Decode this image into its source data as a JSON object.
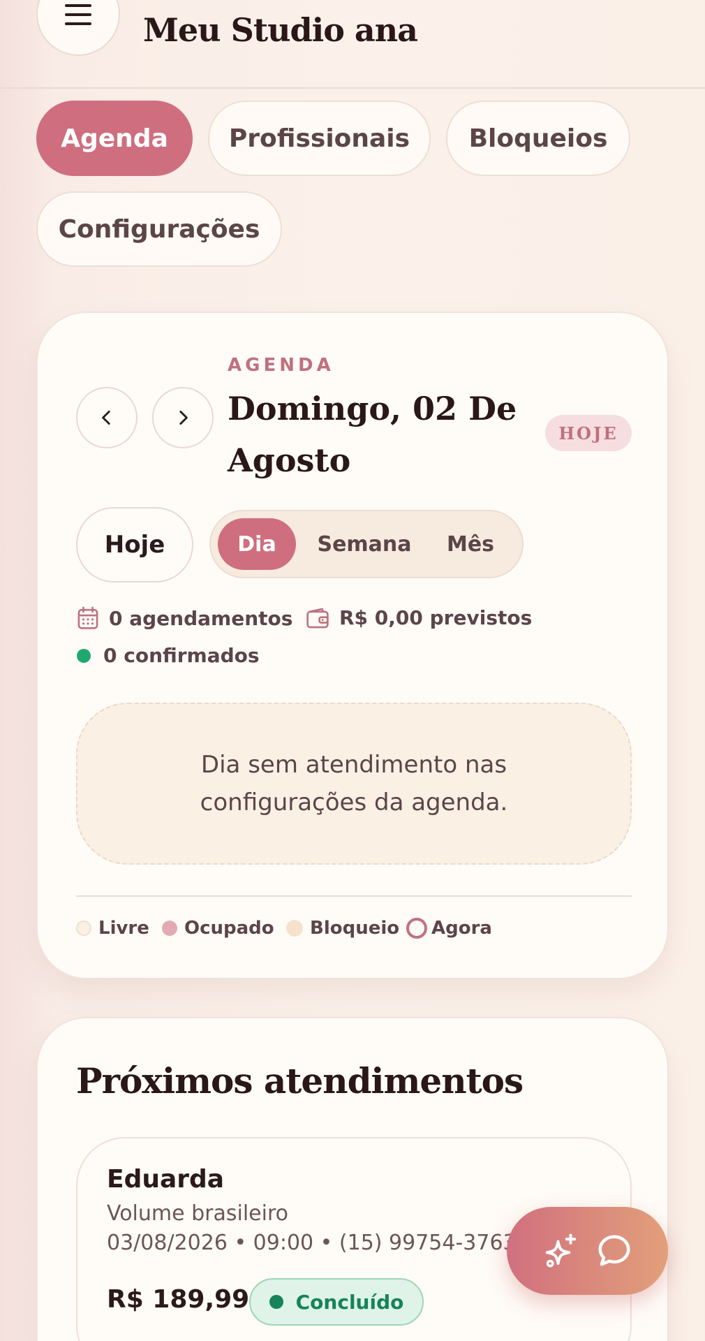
{
  "header": {
    "title": "Meu Studio ana"
  },
  "nav": {
    "tabs": [
      {
        "label": "Agenda",
        "active": true
      },
      {
        "label": "Profissionais",
        "active": false
      },
      {
        "label": "Bloqueios",
        "active": false
      },
      {
        "label": "Configurações",
        "active": false
      }
    ]
  },
  "agenda": {
    "kicker": "AGENDA",
    "date_line1": "Domingo, 02 De",
    "date_line2": "Agosto",
    "today_badge": "HOJE",
    "today_button": "Hoje",
    "view_modes": [
      "Dia",
      "Semana",
      "Mês"
    ],
    "active_view": "Dia",
    "stats": {
      "appointments": "0 agendamentos",
      "forecast": "R$ 0,00 previstos",
      "confirmed": "0 confirmados"
    },
    "empty_line1": "Dia sem atendimento nas",
    "empty_line2": "configurações da agenda.",
    "legend": [
      {
        "label": "Livre",
        "color": "#fbf0e4"
      },
      {
        "label": "Ocupado",
        "color": "#e3aab4"
      },
      {
        "label": "Bloqueio",
        "color": "#f6e1cd"
      },
      {
        "label": "Agora",
        "color": "#c0707e"
      }
    ]
  },
  "upcoming": {
    "title": "Próximos atendimentos",
    "items": [
      {
        "client": "Eduarda",
        "service": "Volume brasileiro",
        "meta": "03/08/2026 • 09:00 • (15) 99754-3763",
        "price": "R$ 189,99",
        "status": "Concluído"
      }
    ]
  },
  "fab": {
    "icons": [
      "sparkles-icon",
      "chat-bubble-icon"
    ]
  },
  "colors": {
    "accent": "#cf6e7e",
    "success": "#17835a",
    "background": "#fbf1ea"
  }
}
